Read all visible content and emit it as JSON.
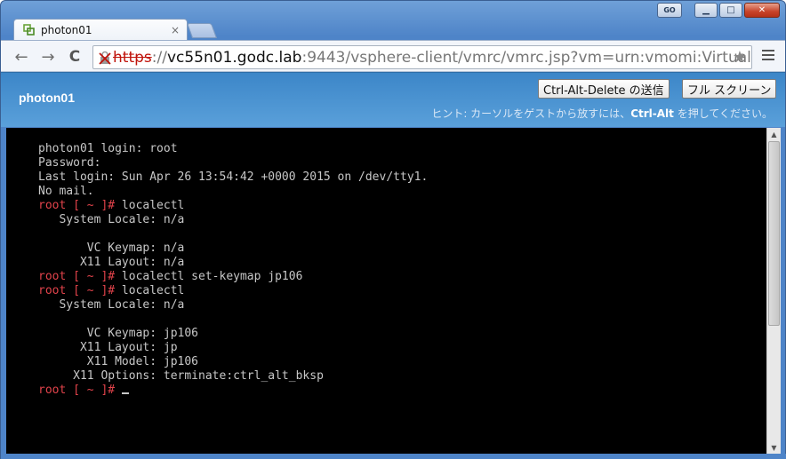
{
  "window": {
    "go_label": "GO",
    "minimize_glyph": "▁",
    "maximize_glyph": "□",
    "close_glyph": "✕"
  },
  "tab": {
    "title": "photon01",
    "close_glyph": "×",
    "favicon": "vsphere-icon"
  },
  "toolbar": {
    "back_glyph": "←",
    "forward_glyph": "→",
    "reload_glyph": "C",
    "url_scheme": "https",
    "url_sep": "://",
    "url_host": "vc55n01.godc.lab",
    "url_rest": ":9443/vsphere-client/vmrc/vmrc.jsp?vm=urn:vmomi:VirtualM",
    "star_glyph": "★"
  },
  "vmrc": {
    "vm_name": "photon01",
    "ctrl_alt_del_label": "Ctrl-Alt-Delete の送信",
    "fullscreen_label": "フル スクリーン",
    "hint_prefix": "ヒント: カーソルをゲストから放すには、",
    "hint_key": "Ctrl-Alt",
    "hint_suffix": " を押してください。"
  },
  "console": {
    "lines": [
      {
        "text": "photon01 login: root"
      },
      {
        "text": "Password:"
      },
      {
        "text": "Last login: Sun Apr 26 13:54:42 +0000 2015 on /dev/tty1."
      },
      {
        "text": "No mail."
      },
      {
        "prompt": "root [ ~ ]#",
        "text": " localectl"
      },
      {
        "text": "   System Locale: n/a"
      },
      {
        "text": ""
      },
      {
        "text": "       VC Keymap: n/a"
      },
      {
        "text": "      X11 Layout: n/a"
      },
      {
        "prompt": "root [ ~ ]#",
        "text": " localectl set-keymap jp106"
      },
      {
        "prompt": "root [ ~ ]#",
        "text": " localectl"
      },
      {
        "text": "   System Locale: n/a"
      },
      {
        "text": ""
      },
      {
        "text": "       VC Keymap: jp106"
      },
      {
        "text": "      X11 Layout: jp"
      },
      {
        "text": "       X11 Model: jp106"
      },
      {
        "text": "     X11 Options: terminate:ctrl_alt_bksp"
      },
      {
        "prompt": "root [ ~ ]#",
        "text": " ",
        "cursor": true
      }
    ]
  },
  "colors": {
    "prompt": "#e2434b",
    "console_text": "#c7c7c7",
    "console_bg": "#000000",
    "header_blue": "#3c86c8",
    "url_error": "#c0140c"
  }
}
